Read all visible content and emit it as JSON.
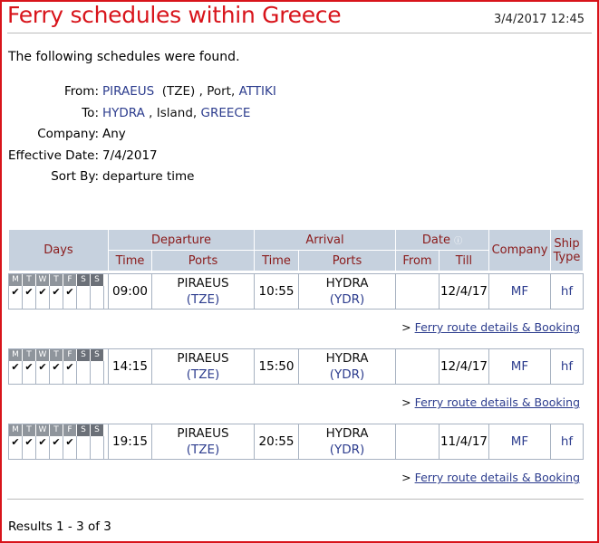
{
  "header": {
    "title": "Ferry schedules within Greece",
    "datetime": "3/4/2017 12:45"
  },
  "intro": "The following schedules were found.",
  "criteria": {
    "from_label": "From:",
    "from_port": "PIRAEUS",
    "from_code": "(TZE)",
    "from_mid": ", Port,",
    "from_region": "ATTIKI",
    "to_label": "To:",
    "to_port": "HYDRA",
    "to_mid": ", Island,",
    "to_region": "GREECE",
    "company_label": "Company:",
    "company_value": "Any",
    "date_label": "Effective Date:",
    "date_value": "7/4/2017",
    "sort_label": "Sort By:",
    "sort_value": "departure time"
  },
  "table_headers": {
    "days": "Days",
    "departure": "Departure",
    "arrival": "Arrival",
    "date": "Date",
    "company": "Company",
    "ship_type": "Ship Type",
    "time": "Time",
    "ports": "Ports",
    "from": "From",
    "till": "Till"
  },
  "day_letters": [
    "M",
    "T",
    "W",
    "T",
    "F",
    "S",
    "S"
  ],
  "info_icon": "info-icon",
  "schedules": [
    {
      "checks": [
        "✔",
        "✔",
        "✔",
        "✔",
        "✔",
        "",
        ""
      ],
      "dep_time": "09:00",
      "dep_port": "PIRAEUS",
      "dep_code": "(TZE)",
      "arr_time": "10:55",
      "arr_port": "HYDRA",
      "arr_code": "(YDR)",
      "from": "",
      "till": "12/4/17",
      "company": "MF",
      "ship_type": "hf"
    },
    {
      "checks": [
        "✔",
        "✔",
        "✔",
        "✔",
        "✔",
        "",
        ""
      ],
      "dep_time": "14:15",
      "dep_port": "PIRAEUS",
      "dep_code": "(TZE)",
      "arr_time": "15:50",
      "arr_port": "HYDRA",
      "arr_code": "(YDR)",
      "from": "",
      "till": "12/4/17",
      "company": "MF",
      "ship_type": "hf"
    },
    {
      "checks": [
        "✔",
        "✔",
        "✔",
        "✔",
        "✔",
        "",
        ""
      ],
      "dep_time": "19:15",
      "dep_port": "PIRAEUS",
      "dep_code": "(TZE)",
      "arr_time": "20:55",
      "arr_port": "HYDRA",
      "arr_code": "(YDR)",
      "from": "",
      "till": "11/4/17",
      "company": "MF",
      "ship_type": "hf"
    }
  ],
  "booking_arrow": ">",
  "booking_link": "Ferry route details & Booking",
  "results": "Results 1 - 3 of 3",
  "colors": {
    "accent": "#d8141b",
    "link": "#2d3d8e",
    "header_bg": "#c6d1de"
  }
}
